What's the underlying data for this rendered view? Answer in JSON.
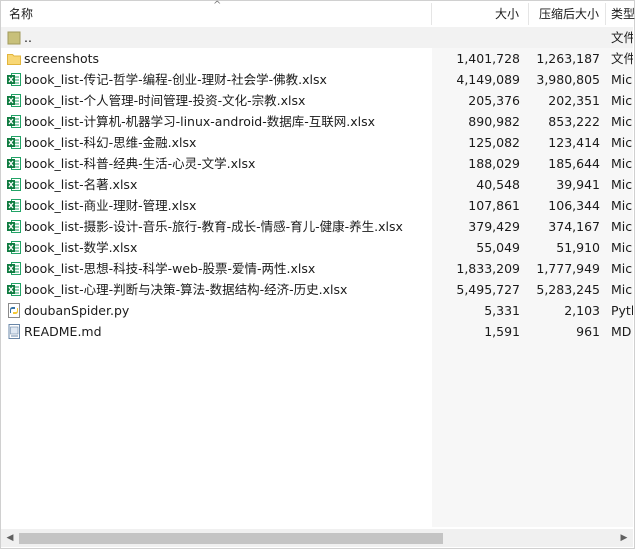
{
  "columns": {
    "name": "名称",
    "size": "大小",
    "compressed": "压缩后大小",
    "type": "类型"
  },
  "rows": [
    {
      "name": "..",
      "size": "",
      "compressed": "",
      "type": "文件",
      "icon": "parent-folder-icon"
    },
    {
      "name": "screenshots",
      "size": "1,401,728",
      "compressed": "1,263,187",
      "type": "文件",
      "icon": "folder-icon"
    },
    {
      "name": "book_list-传记-哲学-编程-创业-理财-社会学-佛教.xlsx",
      "size": "4,149,089",
      "compressed": "3,980,805",
      "type": "Mic",
      "icon": "excel-icon"
    },
    {
      "name": "book_list-个人管理-时间管理-投资-文化-宗教.xlsx",
      "size": "205,376",
      "compressed": "202,351",
      "type": "Mic",
      "icon": "excel-icon"
    },
    {
      "name": "book_list-计算机-机器学习-linux-android-数据库-互联网.xlsx",
      "size": "890,982",
      "compressed": "853,222",
      "type": "Mic",
      "icon": "excel-icon"
    },
    {
      "name": "book_list-科幻-思维-金融.xlsx",
      "size": "125,082",
      "compressed": "123,414",
      "type": "Mic",
      "icon": "excel-icon"
    },
    {
      "name": "book_list-科普-经典-生活-心灵-文学.xlsx",
      "size": "188,029",
      "compressed": "185,644",
      "type": "Mic",
      "icon": "excel-icon"
    },
    {
      "name": "book_list-名著.xlsx",
      "size": "40,548",
      "compressed": "39,941",
      "type": "Mic",
      "icon": "excel-icon"
    },
    {
      "name": "book_list-商业-理财-管理.xlsx",
      "size": "107,861",
      "compressed": "106,344",
      "type": "Mic",
      "icon": "excel-icon"
    },
    {
      "name": "book_list-摄影-设计-音乐-旅行-教育-成长-情感-育儿-健康-养生.xlsx",
      "size": "379,429",
      "compressed": "374,167",
      "type": "Mic",
      "icon": "excel-icon"
    },
    {
      "name": "book_list-数学.xlsx",
      "size": "55,049",
      "compressed": "51,910",
      "type": "Mic",
      "icon": "excel-icon"
    },
    {
      "name": "book_list-思想-科技-科学-web-股票-爱情-两性.xlsx",
      "size": "1,833,209",
      "compressed": "1,777,949",
      "type": "Mic",
      "icon": "excel-icon"
    },
    {
      "name": "book_list-心理-判断与决策-算法-数据结构-经济-历史.xlsx",
      "size": "5,495,727",
      "compressed": "5,283,245",
      "type": "Mic",
      "icon": "excel-icon"
    },
    {
      "name": "doubanSpider.py",
      "size": "5,331",
      "compressed": "2,103",
      "type": "Pyth",
      "icon": "python-file-icon"
    },
    {
      "name": "README.md",
      "size": "1,591",
      "compressed": "961",
      "type": "MD",
      "icon": "markdown-file-icon"
    }
  ]
}
